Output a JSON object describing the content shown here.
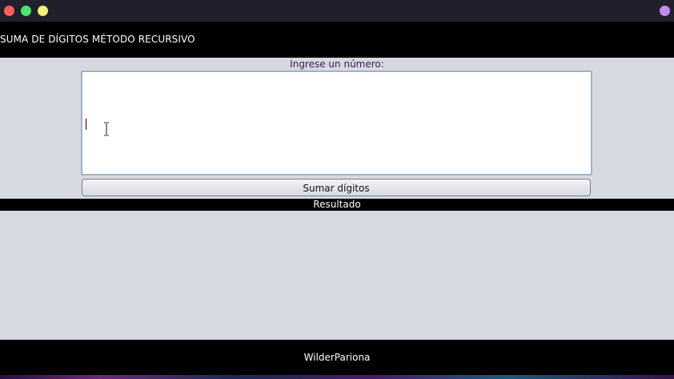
{
  "window": {
    "title": "SUMA DE DÍGITOS MÉTODO RECURSIVO"
  },
  "form": {
    "prompt_label": "Ingrese un número:",
    "input_value": "",
    "submit_label": "Sumar dígitos"
  },
  "result": {
    "header_label": "Resultado",
    "value": ""
  },
  "footer": {
    "author": "WilderPariona"
  },
  "colors": {
    "titlebar": "#20202c",
    "header": "#000000",
    "panel": "#d6d9e0",
    "prompt_text": "#3a1a52"
  }
}
